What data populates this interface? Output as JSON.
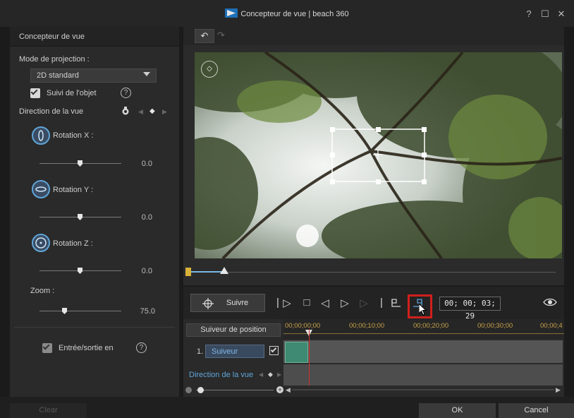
{
  "window": {
    "title": "Concepteur de vue  |  beach 360",
    "help_label": "?",
    "maximize_label": "☐",
    "close_label": "✕"
  },
  "left_panel": {
    "header": "Concepteur de vue",
    "projection_label": "Mode de projection :",
    "projection_value": "2D standard",
    "track_object_label": "Suivi de l'objet",
    "track_object_checked": true,
    "direction_label": "Direction de la vue",
    "rotations": [
      {
        "label": "Rotation X :",
        "value": "0.0",
        "level": 0.5
      },
      {
        "label": "Rotation Y :",
        "value": "0.0",
        "level": 0.5
      },
      {
        "label": "Rotation Z :",
        "value": "0.0",
        "level": 0.5
      }
    ],
    "zoom_label": "Zoom :",
    "zoom_value": "75.0",
    "zoom_level": 0.32,
    "inout_label": "Entrée/sortie en",
    "inout_checked": true
  },
  "toolbar": {
    "undo_icon": "↶",
    "redo_icon": "↷"
  },
  "controls": {
    "follow_label": "Suivre",
    "timecode": "00; 00; 03; 29"
  },
  "timeline": {
    "position_tracker_label": "Suiveur de position",
    "ruler_ticks": [
      "00;00;00;00",
      "00;00;10;00",
      "00;00;20;00",
      "00;00;30;00",
      "00;00;4"
    ],
    "track1_index": "1.",
    "track1_name": "Suiveur",
    "track1_checked": true,
    "track2_name": "Direction de la vue"
  },
  "footer": {
    "clear_label": "Clear",
    "ok_label": "OK",
    "cancel_label": "Cancel"
  },
  "colors": {
    "accent_blue": "#5fa5d8",
    "highlight_red": "#d0201c",
    "clip_green": "#3f8a72",
    "timecode_gold": "#c8a24a"
  }
}
